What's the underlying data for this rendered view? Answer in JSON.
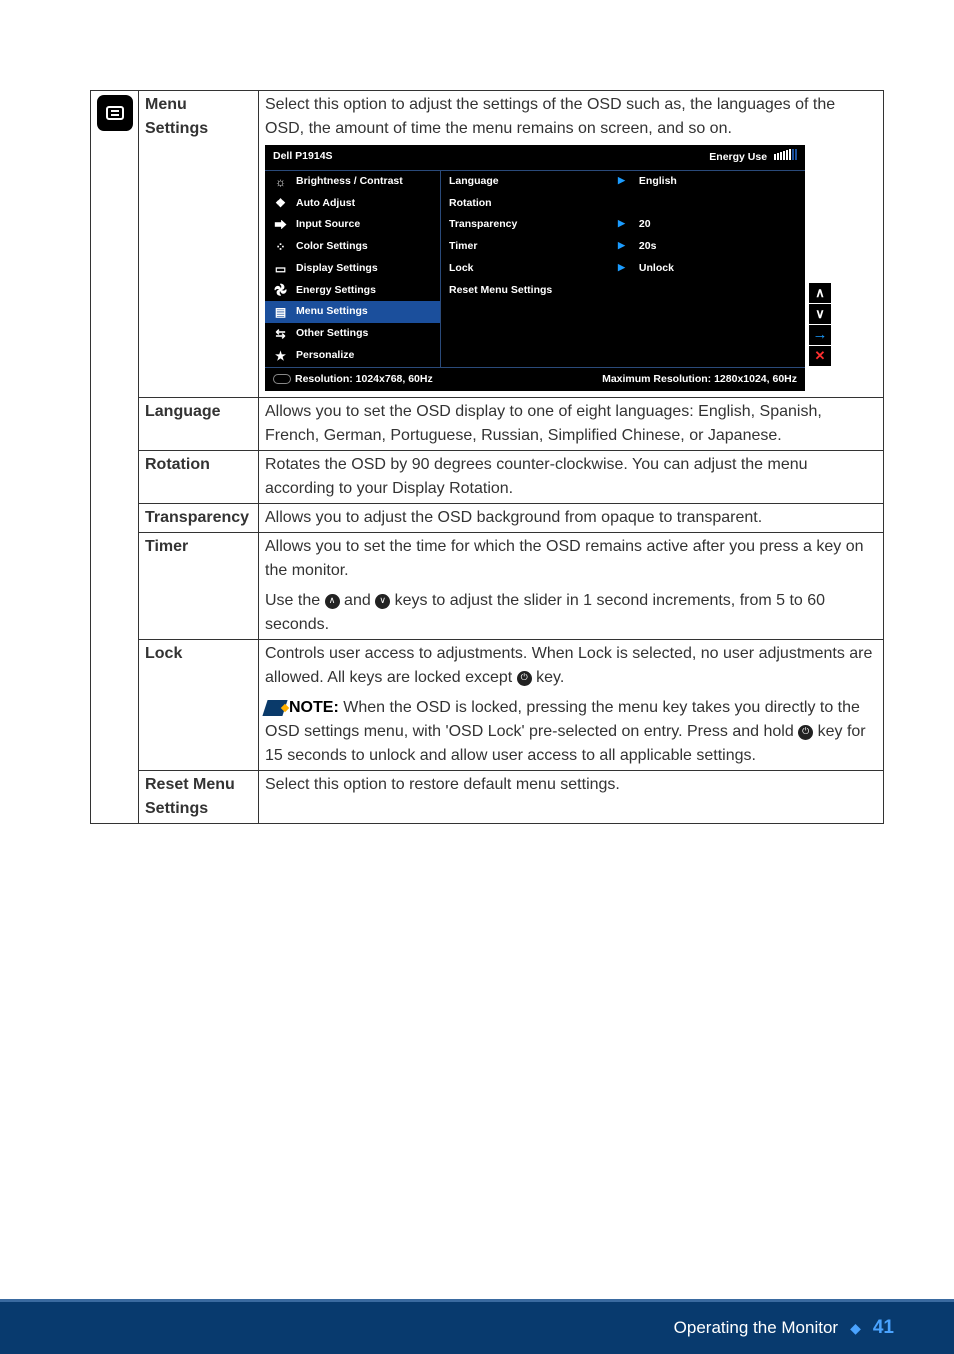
{
  "page": {
    "footer_title": "Operating the Monitor",
    "page_number": "41"
  },
  "rows": {
    "menu_settings": {
      "label1": "Menu",
      "label2": "Settings",
      "desc": "Select this option to adjust the settings of the OSD such as, the languages of the OSD, the amount of time the menu remains on screen, and so on."
    },
    "language": {
      "label": "Language",
      "desc": "Allows you to set the OSD display to one of eight languages: English, Spanish, French, German, Portuguese, Russian, Simplified Chinese, or Japanese."
    },
    "rotation": {
      "label": "Rotation",
      "desc": "Rotates the OSD by 90 degrees counter-clockwise. You can adjust the menu according to your Display Rotation."
    },
    "transparency": {
      "label": "Transparency",
      "desc": "Allows you to adjust the OSD background from opaque to transparent."
    },
    "timer": {
      "label": "Timer",
      "desc1": "Allows you to set the time for which the OSD remains active after you press a key on the monitor.",
      "desc2a": "Use the ",
      "desc2b": " and ",
      "desc2c": " keys to adjust the slider in 1 second increments, from 5 to 60 seconds."
    },
    "lock": {
      "label": "Lock",
      "desc1a": "Controls user access to adjustments. When Lock is selected, no user adjustments are allowed. All keys are locked except ",
      "desc1b": " key.",
      "note_label": "NOTE:",
      "note_a": " When the OSD is locked, pressing the menu key takes you directly to the OSD settings menu, with 'OSD Lock' pre-selected on entry. Press and hold ",
      "note_b": " key for 15 seconds to unlock and allow user access to all applicable settings."
    },
    "reset": {
      "label1": "Reset Menu",
      "label2": "Settings",
      "desc": "Select this option to restore default menu settings."
    }
  },
  "osd": {
    "title": "Dell P1914S",
    "energy": "Energy Use",
    "left": [
      "Brightness / Contrast",
      "Auto Adjust",
      "Input Source",
      "Color Settings",
      "Display Settings",
      "Energy Settings",
      "Menu Settings",
      "Other Settings",
      "Personalize"
    ],
    "mid": [
      "Language",
      "Rotation",
      "Transparency",
      "Timer",
      "Lock",
      "Reset Menu Settings"
    ],
    "right": {
      "language": "English",
      "transparency": "20",
      "timer": "20s",
      "lock": "Unlock"
    },
    "bottom_left": "Resolution: 1024x768,  60Hz",
    "bottom_right": "Maximum Resolution: 1280x1024,  60Hz"
  }
}
